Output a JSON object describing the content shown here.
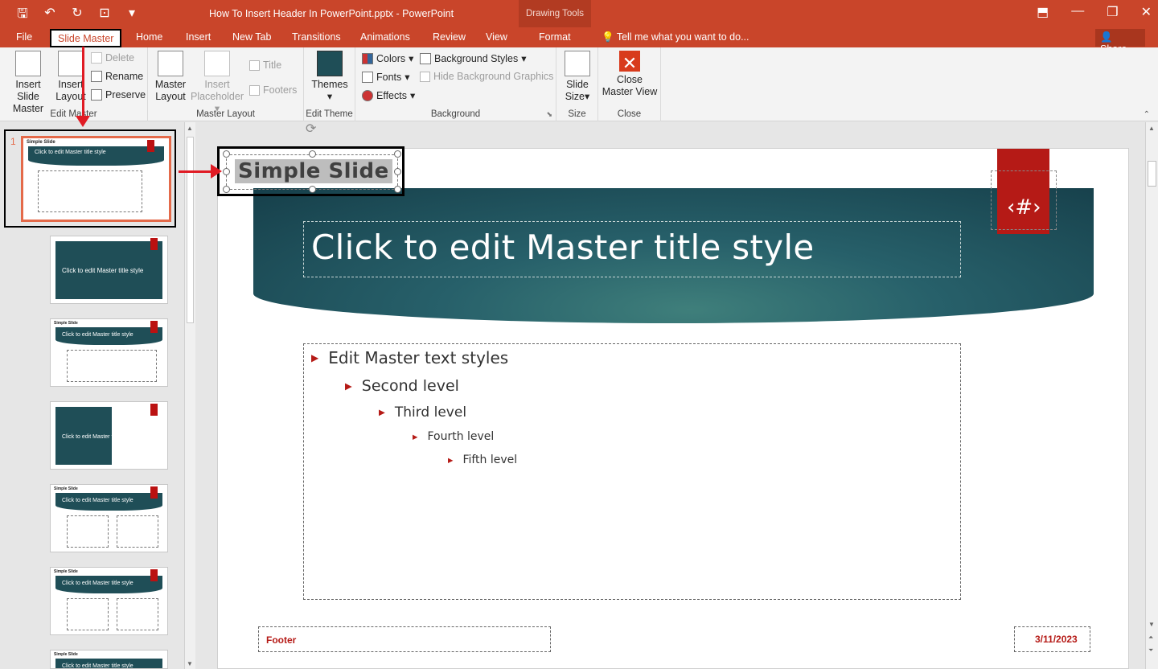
{
  "titlebar": {
    "document_title": "How To Insert Header In PowerPoint.pptx - PowerPoint",
    "context_label": "Drawing Tools"
  },
  "tabs": {
    "file": "File",
    "slide_master": "Slide Master",
    "home": "Home",
    "insert": "Insert",
    "new_tab": "New Tab",
    "transitions": "Transitions",
    "animations": "Animations",
    "review": "Review",
    "view": "View",
    "format": "Format",
    "tell_me": "Tell me what you want to do...",
    "share": "Share"
  },
  "ribbon": {
    "edit_master": {
      "label": "Edit Master",
      "insert_slide_master_1": "Insert Slide",
      "insert_slide_master_2": "Master",
      "insert_layout_1": "Insert",
      "insert_layout_2": "Layout",
      "delete": "Delete",
      "rename": "Rename",
      "preserve": "Preserve"
    },
    "master_layout": {
      "label": "Master Layout",
      "master_layout_1": "Master",
      "master_layout_2": "Layout",
      "insert_placeholder_1": "Insert",
      "insert_placeholder_2": "Placeholder",
      "title": "Title",
      "footers": "Footers"
    },
    "edit_theme": {
      "label": "Edit Theme",
      "themes": "Themes"
    },
    "background": {
      "label": "Background",
      "colors": "Colors",
      "fonts": "Fonts",
      "effects": "Effects",
      "background_styles": "Background Styles",
      "hide_bg": "Hide Background Graphics"
    },
    "size": {
      "label": "Size",
      "slide_size_1": "Slide",
      "slide_size_2": "Size"
    },
    "close": {
      "label": "Close",
      "close_1": "Close",
      "close_2": "Master View"
    }
  },
  "thumbnails": {
    "selected_number": "1",
    "header_text": "Simple Slide",
    "title_text": "Click to edit Master title style"
  },
  "slide": {
    "header_text": "Simple Slide",
    "title": "Click to edit Master title style",
    "slide_number": "‹#›",
    "levels": [
      "Edit Master text styles",
      "Second level",
      "Third level",
      "Fourth level",
      "Fifth level"
    ],
    "footer": "Footer",
    "date": "3/11/2023"
  },
  "colors": {
    "accent": "#c9452a",
    "teal": "#1f4e57",
    "red": "#b51a16"
  }
}
